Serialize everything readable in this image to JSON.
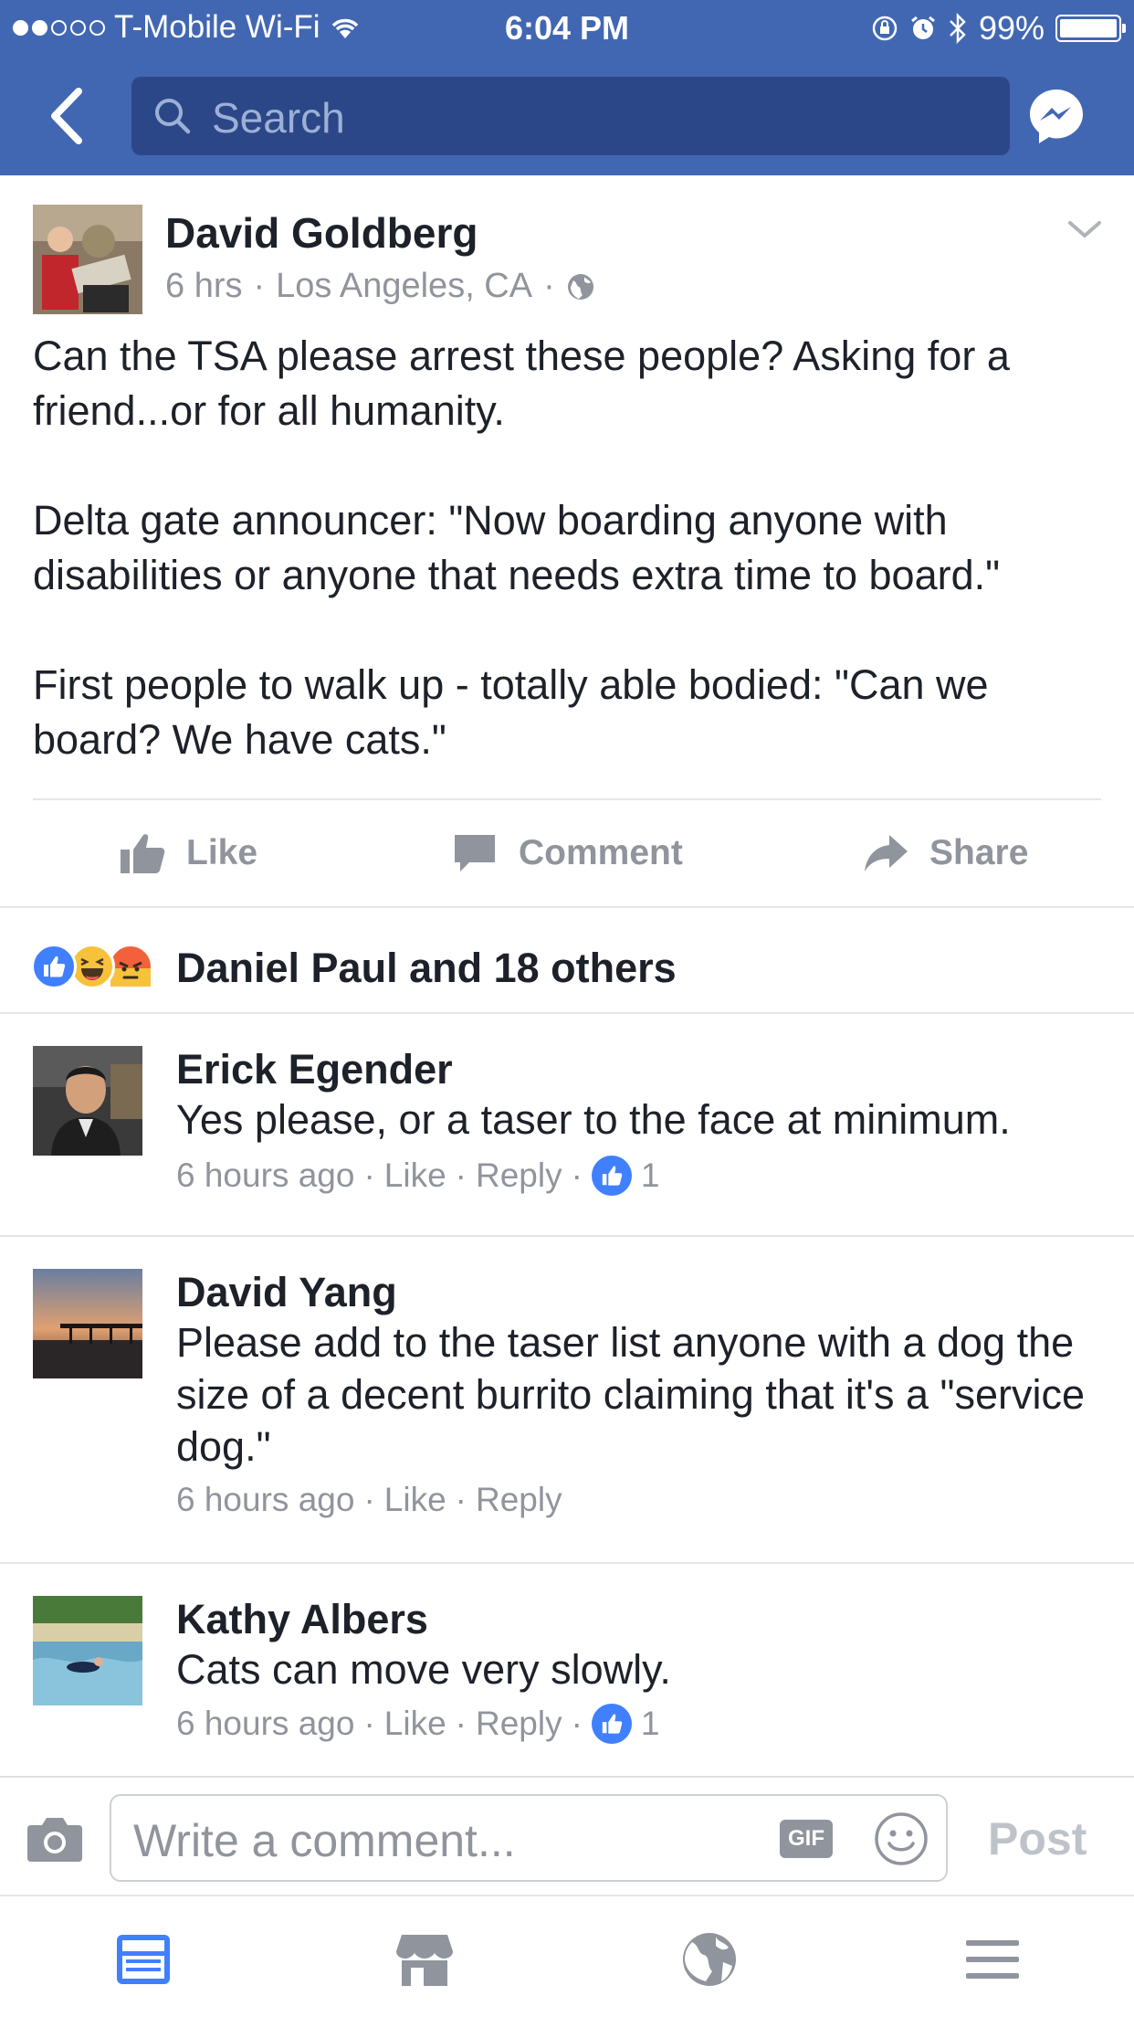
{
  "status_bar": {
    "carrier": "T-Mobile Wi-Fi",
    "time": "6:04 PM",
    "battery": "99%",
    "signal_bars_filled": 2,
    "signal_bars_total": 5
  },
  "nav": {
    "search_placeholder": "Search"
  },
  "post": {
    "author": "David Goldberg",
    "time": "6 hrs",
    "location": "Los Angeles, CA",
    "paragraphs": [
      "Can the TSA please arrest these people?  Asking for a friend...or for all humanity.",
      "Delta gate announcer: \"Now boarding anyone with disabilities or anyone that needs extra time to board.\"",
      "First people to walk up - totally able bodied: \"Can we board? We have cats.\""
    ],
    "actions": {
      "like": "Like",
      "comment": "Comment",
      "share": "Share"
    },
    "reactions_summary": "Daniel Paul and 18 others"
  },
  "comments": [
    {
      "name": "Erick Egender",
      "text": "Yes please, or a taser to the face at minimum.",
      "time": "6 hours ago",
      "like": "Like",
      "reply": "Reply",
      "likes": "1"
    },
    {
      "name": "David Yang",
      "text": "Please add to the taser list anyone with a dog the size of a decent burrito claiming that it's a \"service dog.\"",
      "time": "6 hours ago",
      "like": "Like",
      "reply": "Reply"
    },
    {
      "name": "Kathy Albers",
      "text": "Cats can move very slowly.",
      "time": "6 hours ago",
      "like": "Like",
      "reply": "Reply",
      "likes": "1"
    }
  ],
  "composer": {
    "placeholder": "Write a comment...",
    "gif_label": "GIF",
    "post_label": "Post"
  },
  "colors": {
    "brand": "#4267b2",
    "search_bg": "#2c4788",
    "meta_text": "#90949c",
    "like_blue": "#4080ff",
    "active_tab": "#4080ff"
  }
}
